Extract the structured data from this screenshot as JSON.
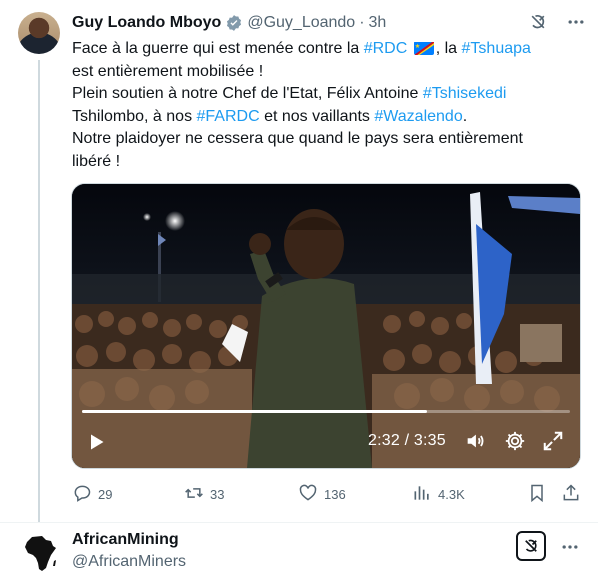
{
  "tweet": {
    "author_name": "Guy Loando Mboyo",
    "handle": "@Guy_Loando",
    "separator": "·",
    "time": "3h",
    "text": {
      "l1_a": "Face à la guerre qui est menée contre la ",
      "l1_tag1": "#RDC",
      "l1_b": ", la ",
      "l1_tag2": "#Tshuapa",
      "l2": "est entièrement mobilisée !",
      "l3_a": "Plein soutien à notre Chef de l'Etat, Félix Antoine ",
      "l3_tag": "#Tshisekedi",
      "l4_a": "Tshilombo, à nos ",
      "l4_tag1": "#FARDC",
      "l4_b": " et nos vaillants ",
      "l4_tag2": "#Wazalendo",
      "l4_c": ".",
      "l5": "Notre plaidoyer ne cessera que quand le pays sera entièrement",
      "l6": "libéré !"
    },
    "video": {
      "current_time": "2:32",
      "duration": "3:35",
      "time_sep": " / ",
      "progress": 0.707
    },
    "stats": {
      "replies": "29",
      "reposts": "33",
      "likes": "136",
      "views": "4.3K"
    }
  },
  "reply_preview": {
    "author_name": "AfricanMining",
    "handle": "@AfricanMiners"
  },
  "colors": {
    "accent": "#1d9bf0",
    "muted": "#536471",
    "text": "#0f1419",
    "border": "#cfd9de"
  },
  "icons": {
    "verified": "verified-badge-icon",
    "grok": "grok-icon",
    "more": "more-icon",
    "reply": "reply-icon",
    "repost": "repost-icon",
    "like": "like-icon",
    "views": "views-icon",
    "bookmark": "bookmark-icon",
    "share": "share-icon"
  }
}
